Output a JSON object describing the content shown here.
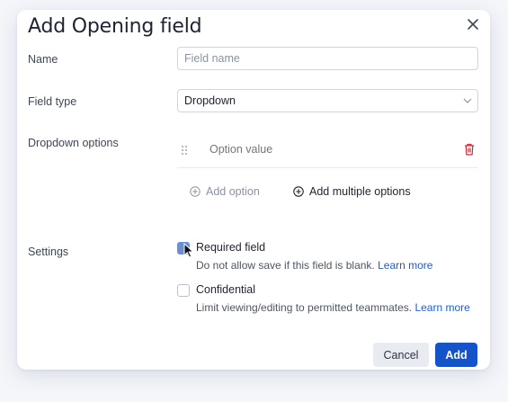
{
  "dialog": {
    "title": "Add Opening field",
    "close_icon": "close-icon"
  },
  "name_field": {
    "label": "Name",
    "placeholder": "Field name",
    "value": ""
  },
  "field_type": {
    "label": "Field type",
    "selected": "Dropdown"
  },
  "dropdown_options": {
    "label": "Dropdown options",
    "options": [
      {
        "placeholder": "Option value",
        "value": ""
      }
    ],
    "add_option_label": "Add option",
    "add_multiple_label": "Add multiple options"
  },
  "settings": {
    "label": "Settings",
    "required": {
      "label": "Required field",
      "checked": true,
      "help": "Do not allow save if this field is blank.",
      "link": "Learn more"
    },
    "confidential": {
      "label": "Confidential",
      "checked": false,
      "help": "Limit viewing/editing to permitted teammates.",
      "link": "Learn more"
    }
  },
  "footer": {
    "cancel_label": "Cancel",
    "add_label": "Add"
  },
  "colors": {
    "primary": "#1453c9",
    "danger": "#c62a3a",
    "checkbox_checked": "#6c8fd4",
    "link": "#1f5ccc"
  }
}
